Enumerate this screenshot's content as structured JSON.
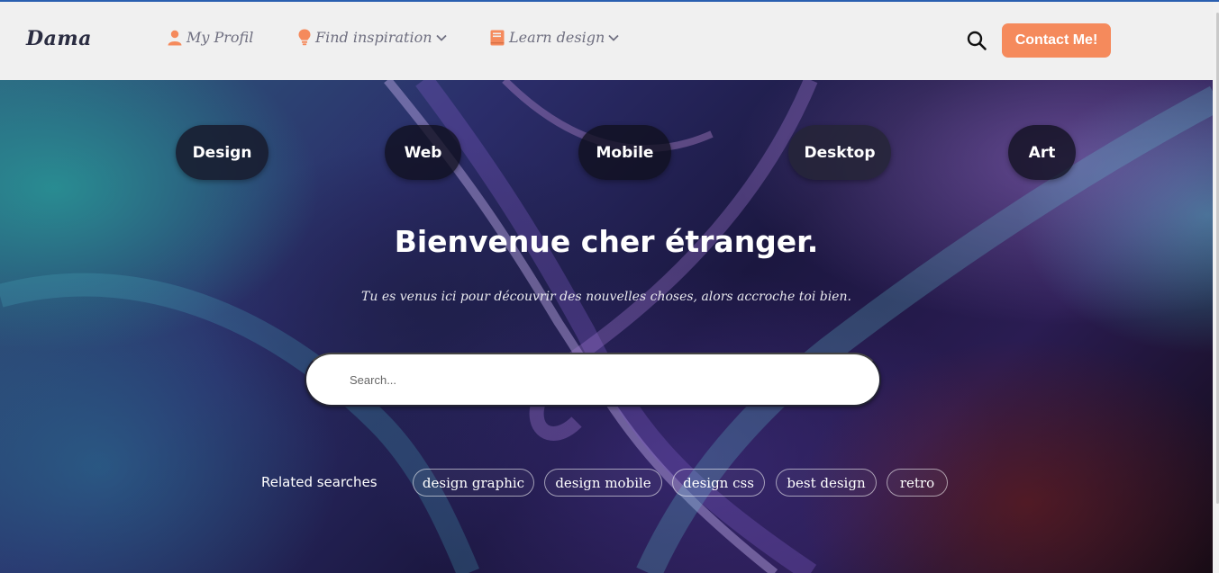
{
  "navbar": {
    "brand": "Dama",
    "items": [
      {
        "label": "My Profil",
        "icon": "user-icon"
      },
      {
        "label": "Find inspiration",
        "icon": "lightbulb-icon",
        "dropdown": true
      },
      {
        "label": "Learn design",
        "icon": "book-icon",
        "dropdown": true
      }
    ],
    "search_icon": "search-icon",
    "contact_label": "Contact Me!"
  },
  "hero": {
    "categories": [
      "Design",
      "Web",
      "Mobile",
      "Desktop",
      "Art"
    ],
    "title": "Bienvenue cher étranger.",
    "subtitle": "Tu es venus ici pour découvrir des nouvelles choses, alors accroche toi bien.",
    "search_placeholder": "Search...",
    "related_label": "Related searches",
    "related_tags": [
      "design graphic",
      "design mobile",
      "design css",
      "best design",
      "retro"
    ]
  },
  "colors": {
    "accent": "#f58a5c",
    "navbar_bg": "#f0f0f0",
    "brand": "#2b2d42",
    "nav_text": "#6f6f80",
    "top_line": "#2a5fb0"
  }
}
